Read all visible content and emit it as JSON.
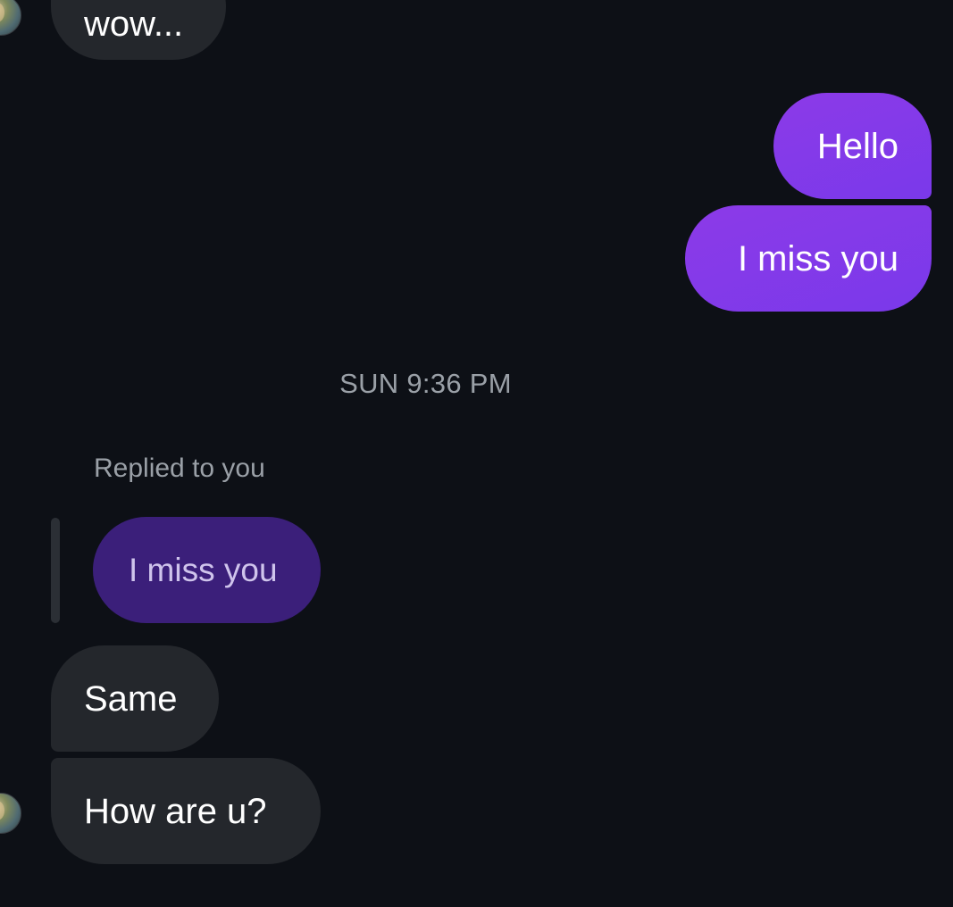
{
  "messages": {
    "prev_received": "wow...",
    "sent_1": "Hello",
    "sent_2": "I miss you",
    "received_1": "Same",
    "received_2": "How are u?"
  },
  "timestamp": "SUN 9:36 PM",
  "reply": {
    "label": "Replied to you",
    "quoted_text": "I miss you"
  },
  "colors": {
    "background": "#0d1016",
    "sent_bubble": "#8438e9",
    "received_bubble": "#24272c",
    "quoted_bubble": "#3b1f7a",
    "meta_text": "#9aa0a7"
  }
}
